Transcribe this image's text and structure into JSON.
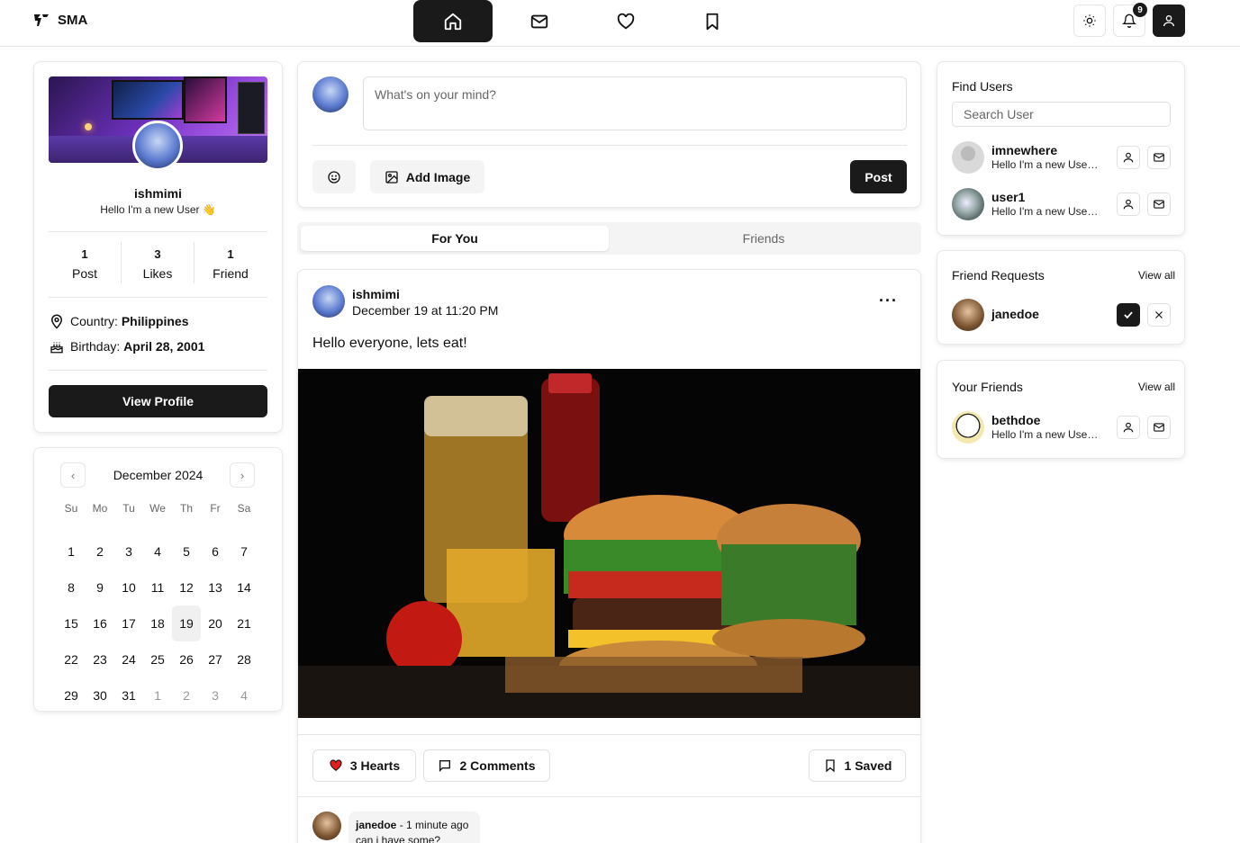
{
  "brand": {
    "name": "SMA",
    "logo_icon": "sma-logo-icon"
  },
  "nav": {
    "items": [
      {
        "name": "home",
        "icon": "home-icon",
        "active": true
      },
      {
        "name": "messages",
        "icon": "mail-icon",
        "active": false
      },
      {
        "name": "likes",
        "icon": "heart-icon",
        "active": false
      },
      {
        "name": "saved",
        "icon": "bookmark-icon",
        "active": false
      }
    ]
  },
  "toolbar": {
    "theme_icon": "sun-icon",
    "notifications_icon": "bell-icon",
    "notifications_count": "9",
    "account_icon": "user-icon"
  },
  "profile": {
    "name": "ishmimi",
    "bio": "Hello I'm a new User 👋",
    "stats": [
      {
        "value": "1",
        "label": "Post"
      },
      {
        "value": "3",
        "label": "Likes"
      },
      {
        "value": "1",
        "label": "Friend"
      }
    ],
    "country_label": "Country: ",
    "country": "Philippines",
    "birthday_label": "Birthday: ",
    "birthday": "April 28, 2001",
    "view_profile_label": "View Profile"
  },
  "calendar": {
    "month": "December 2024",
    "weekdays": [
      "Su",
      "Mo",
      "Tu",
      "We",
      "Th",
      "Fr",
      "Sa"
    ],
    "days": [
      [
        "1",
        "2",
        "3",
        "4",
        "5",
        "6",
        "7"
      ],
      [
        "8",
        "9",
        "10",
        "11",
        "12",
        "13",
        "14"
      ],
      [
        "15",
        "16",
        "17",
        "18",
        "19",
        "20",
        "21"
      ],
      [
        "22",
        "23",
        "24",
        "25",
        "26",
        "27",
        "28"
      ],
      [
        "29",
        "30",
        "31",
        "1",
        "2",
        "3",
        "4"
      ]
    ],
    "today": "19"
  },
  "composer": {
    "placeholder": "What's on your mind?",
    "emoji_icon": "smile-icon",
    "add_image_label": "Add Image",
    "post_label": "Post"
  },
  "feed_tabs": [
    {
      "label": "For You",
      "active": true
    },
    {
      "label": "Friends",
      "active": false
    }
  ],
  "post": {
    "author": "ishmimi",
    "timestamp": "December 19 at 11:20 PM",
    "text": "Hello everyone, lets eat!",
    "hearts_label": "3 Hearts",
    "comments_label": "2 Comments",
    "saved_label": "1 Saved",
    "image_alt_icon": "burger-photo",
    "comment": {
      "author": "janedoe",
      "time": " - 1 minute ago",
      "text": "can i have some?"
    }
  },
  "find_users": {
    "title": "Find Users",
    "search_placeholder": "Search User",
    "users": [
      {
        "name": "imnewhere",
        "bio": "Hello I'm a new User 👋"
      },
      {
        "name": "user1",
        "bio": "Hello I'm a new User 👋"
      }
    ]
  },
  "friend_requests": {
    "title": "Friend Requests",
    "view_all": "View all",
    "items": [
      {
        "name": "janedoe"
      }
    ]
  },
  "your_friends": {
    "title": "Your Friends",
    "view_all": "View all",
    "items": [
      {
        "name": "bethdoe",
        "bio": "Hello I'm a new User 👋"
      }
    ]
  },
  "colors": {
    "primary": "#1a1a1a",
    "heart": "#e11d1d",
    "muted": "#f4f4f5"
  }
}
